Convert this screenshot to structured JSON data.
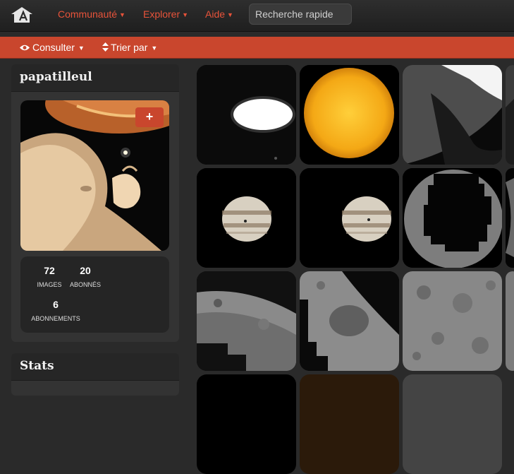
{
  "nav": {
    "items": [
      {
        "label": "Communauté"
      },
      {
        "label": "Explorer"
      },
      {
        "label": "Aide"
      }
    ],
    "search_placeholder": "Recherche rapide",
    "accent": "#e8533a"
  },
  "subnav": {
    "consult_label": "Consulter",
    "sort_label": "Trier par",
    "bar_color": "#c9462d"
  },
  "profile": {
    "username": "papatilleul",
    "follow_symbol": "+",
    "stats": [
      {
        "value": "72",
        "label": "IMAGES"
      },
      {
        "value": "20",
        "label": "ABONNÉS"
      },
      {
        "value": "6",
        "label": "ABONNEMENTS"
      }
    ]
  },
  "stats_panel": {
    "title": "Stats"
  },
  "gallery": {
    "images": [
      {
        "subject": "bright-ellipse"
      },
      {
        "subject": "sun"
      },
      {
        "subject": "moon-limb"
      },
      {
        "subject": "partial"
      },
      {
        "subject": "jupiter"
      },
      {
        "subject": "jupiter"
      },
      {
        "subject": "moon-crescent"
      },
      {
        "subject": "partial"
      },
      {
        "subject": "moon-surface"
      },
      {
        "subject": "moon-crater"
      },
      {
        "subject": "moon-craters"
      },
      {
        "subject": "partial"
      }
    ]
  }
}
